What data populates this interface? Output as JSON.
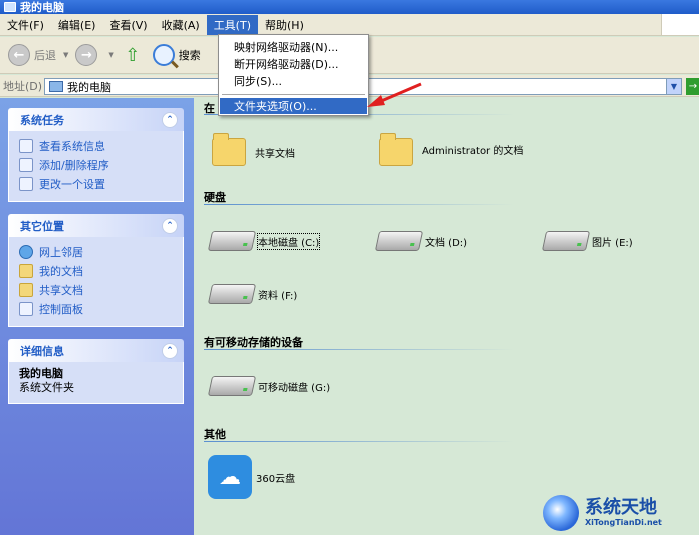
{
  "window": {
    "title": "我的电脑"
  },
  "menu": [
    "文件(F)",
    "编辑(E)",
    "查看(V)",
    "收藏(A)",
    "工具(T)",
    "帮助(H)"
  ],
  "toolbar": {
    "back_label": "后退",
    "search_label": "搜索"
  },
  "address": {
    "label": "地址(D)",
    "value": "我的电脑"
  },
  "tools_menu": {
    "items": [
      "映射网络驱动器(N)...",
      "断开网络驱动器(D)...",
      "同步(S)...",
      "文件夹选项(O)..."
    ],
    "highlighted_index": 3
  },
  "left_panes": {
    "system_tasks": {
      "title": "系统任务",
      "links": [
        "查看系统信息",
        "添加/删除程序",
        "更改一个设置"
      ]
    },
    "other_places": {
      "title": "其它位置",
      "links": [
        "网上邻居",
        "我的文档",
        "共享文档",
        "控制面板"
      ]
    },
    "details": {
      "title": "详细信息",
      "name": "我的电脑",
      "description": "系统文件夹"
    }
  },
  "content": {
    "files_section_heading_partial": "在",
    "folders": [
      "共享文档",
      "Administrator 的文档"
    ],
    "hard_disk_heading": "硬盘",
    "drives": [
      "本地磁盘 (C:)",
      "文档 (D:)",
      "图片 (E:)",
      "资料 (F:)"
    ],
    "removable_heading": "有可移动存储的设备",
    "removable": [
      "可移动磁盘 (G:)"
    ],
    "other_heading": "其他",
    "other_items": [
      "360云盘"
    ]
  },
  "watermark": {
    "title": "系统天地",
    "subtitle": "XiTongTianDi.net"
  },
  "colors": {
    "selection": "#316ac5",
    "arrow": "#e02020",
    "task_link": "#215dc6"
  }
}
